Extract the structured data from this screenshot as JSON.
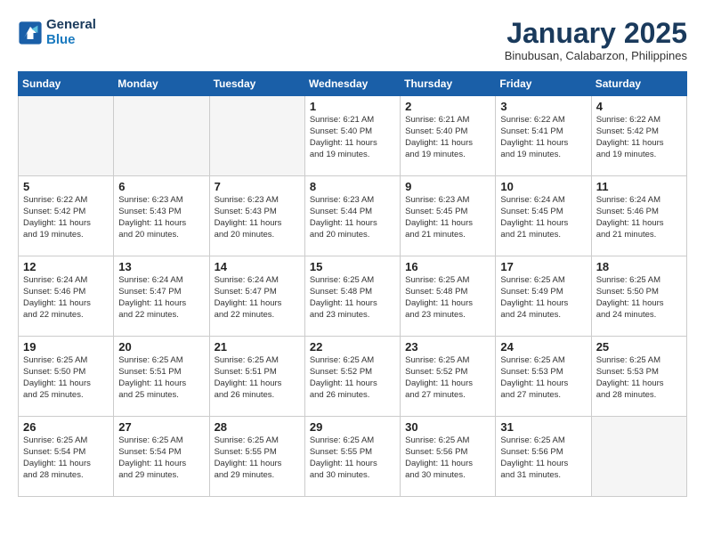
{
  "header": {
    "logo_line1": "General",
    "logo_line2": "Blue",
    "title": "January 2025",
    "subtitle": "Binubusan, Calabarzon, Philippines"
  },
  "weekdays": [
    "Sunday",
    "Monday",
    "Tuesday",
    "Wednesday",
    "Thursday",
    "Friday",
    "Saturday"
  ],
  "weeks": [
    [
      {
        "day": "",
        "info": ""
      },
      {
        "day": "",
        "info": ""
      },
      {
        "day": "",
        "info": ""
      },
      {
        "day": "1",
        "info": "Sunrise: 6:21 AM\nSunset: 5:40 PM\nDaylight: 11 hours\nand 19 minutes."
      },
      {
        "day": "2",
        "info": "Sunrise: 6:21 AM\nSunset: 5:40 PM\nDaylight: 11 hours\nand 19 minutes."
      },
      {
        "day": "3",
        "info": "Sunrise: 6:22 AM\nSunset: 5:41 PM\nDaylight: 11 hours\nand 19 minutes."
      },
      {
        "day": "4",
        "info": "Sunrise: 6:22 AM\nSunset: 5:42 PM\nDaylight: 11 hours\nand 19 minutes."
      }
    ],
    [
      {
        "day": "5",
        "info": "Sunrise: 6:22 AM\nSunset: 5:42 PM\nDaylight: 11 hours\nand 19 minutes."
      },
      {
        "day": "6",
        "info": "Sunrise: 6:23 AM\nSunset: 5:43 PM\nDaylight: 11 hours\nand 20 minutes."
      },
      {
        "day": "7",
        "info": "Sunrise: 6:23 AM\nSunset: 5:43 PM\nDaylight: 11 hours\nand 20 minutes."
      },
      {
        "day": "8",
        "info": "Sunrise: 6:23 AM\nSunset: 5:44 PM\nDaylight: 11 hours\nand 20 minutes."
      },
      {
        "day": "9",
        "info": "Sunrise: 6:23 AM\nSunset: 5:45 PM\nDaylight: 11 hours\nand 21 minutes."
      },
      {
        "day": "10",
        "info": "Sunrise: 6:24 AM\nSunset: 5:45 PM\nDaylight: 11 hours\nand 21 minutes."
      },
      {
        "day": "11",
        "info": "Sunrise: 6:24 AM\nSunset: 5:46 PM\nDaylight: 11 hours\nand 21 minutes."
      }
    ],
    [
      {
        "day": "12",
        "info": "Sunrise: 6:24 AM\nSunset: 5:46 PM\nDaylight: 11 hours\nand 22 minutes."
      },
      {
        "day": "13",
        "info": "Sunrise: 6:24 AM\nSunset: 5:47 PM\nDaylight: 11 hours\nand 22 minutes."
      },
      {
        "day": "14",
        "info": "Sunrise: 6:24 AM\nSunset: 5:47 PM\nDaylight: 11 hours\nand 22 minutes."
      },
      {
        "day": "15",
        "info": "Sunrise: 6:25 AM\nSunset: 5:48 PM\nDaylight: 11 hours\nand 23 minutes."
      },
      {
        "day": "16",
        "info": "Sunrise: 6:25 AM\nSunset: 5:48 PM\nDaylight: 11 hours\nand 23 minutes."
      },
      {
        "day": "17",
        "info": "Sunrise: 6:25 AM\nSunset: 5:49 PM\nDaylight: 11 hours\nand 24 minutes."
      },
      {
        "day": "18",
        "info": "Sunrise: 6:25 AM\nSunset: 5:50 PM\nDaylight: 11 hours\nand 24 minutes."
      }
    ],
    [
      {
        "day": "19",
        "info": "Sunrise: 6:25 AM\nSunset: 5:50 PM\nDaylight: 11 hours\nand 25 minutes."
      },
      {
        "day": "20",
        "info": "Sunrise: 6:25 AM\nSunset: 5:51 PM\nDaylight: 11 hours\nand 25 minutes."
      },
      {
        "day": "21",
        "info": "Sunrise: 6:25 AM\nSunset: 5:51 PM\nDaylight: 11 hours\nand 26 minutes."
      },
      {
        "day": "22",
        "info": "Sunrise: 6:25 AM\nSunset: 5:52 PM\nDaylight: 11 hours\nand 26 minutes."
      },
      {
        "day": "23",
        "info": "Sunrise: 6:25 AM\nSunset: 5:52 PM\nDaylight: 11 hours\nand 27 minutes."
      },
      {
        "day": "24",
        "info": "Sunrise: 6:25 AM\nSunset: 5:53 PM\nDaylight: 11 hours\nand 27 minutes."
      },
      {
        "day": "25",
        "info": "Sunrise: 6:25 AM\nSunset: 5:53 PM\nDaylight: 11 hours\nand 28 minutes."
      }
    ],
    [
      {
        "day": "26",
        "info": "Sunrise: 6:25 AM\nSunset: 5:54 PM\nDaylight: 11 hours\nand 28 minutes."
      },
      {
        "day": "27",
        "info": "Sunrise: 6:25 AM\nSunset: 5:54 PM\nDaylight: 11 hours\nand 29 minutes."
      },
      {
        "day": "28",
        "info": "Sunrise: 6:25 AM\nSunset: 5:55 PM\nDaylight: 11 hours\nand 29 minutes."
      },
      {
        "day": "29",
        "info": "Sunrise: 6:25 AM\nSunset: 5:55 PM\nDaylight: 11 hours\nand 30 minutes."
      },
      {
        "day": "30",
        "info": "Sunrise: 6:25 AM\nSunset: 5:56 PM\nDaylight: 11 hours\nand 30 minutes."
      },
      {
        "day": "31",
        "info": "Sunrise: 6:25 AM\nSunset: 5:56 PM\nDaylight: 11 hours\nand 31 minutes."
      },
      {
        "day": "",
        "info": ""
      }
    ]
  ]
}
